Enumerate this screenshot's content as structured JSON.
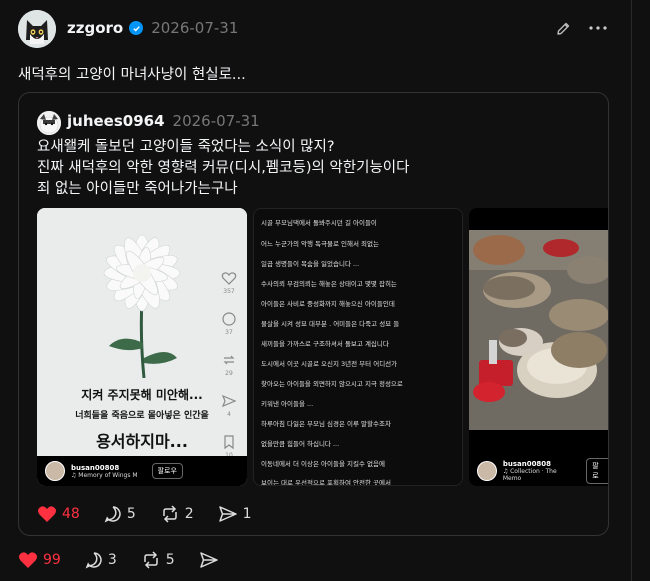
{
  "post": {
    "username": "zzgoro",
    "date": "2026-07-31",
    "text": "새덕후의 고양이 마녀사냥이 현실로...",
    "stats": {
      "likes": "99",
      "comments": "3",
      "reposts": "5"
    }
  },
  "quote": {
    "username": "juhees0964",
    "date": "2026-07-31",
    "lines": [
      "요새왤케 돌보던 고양이들 죽었다는 소식이 많지?",
      "진짜 새덕후의 악한 영향력 커뮤(디시,펨코등)의 악한기능이다",
      "죄 없는 아이들만 죽어나가는구나"
    ],
    "stats": {
      "likes": "48",
      "comments": "5",
      "reposts": "2",
      "shares": "1"
    },
    "media1": {
      "caption1": "지켜 주지못해 미안해...",
      "caption2": "너희들을 죽음으로 몰아넣은 인간을",
      "caption3": "용서하지마...",
      "counts": [
        "357",
        "37",
        "29",
        "4",
        "10"
      ],
      "username": "busan00808",
      "music": "♫ Memory of Wings   M",
      "follow": "팔로우"
    },
    "media2": {
      "lines": [
        "시골 부모님댁에서 돌봐주시던 길 아이들이",
        "어느 누군가의 악행 독극물로 인해서 죄없는",
        "일곱 생명들이 목숨을 잃었습니다 ...",
        "수사의뢰 부검의뢰는 해놓은 상태이고 몇몇 잡히는",
        "아이들은 사비로 중성화까지 해놓으신 아이들인데",
        "물살을 시켜 성묘 대부분 . 어미들은 다죽고 성묘 들",
        "새끼들을 가까스로 구조하셔서 돌보고 계십니다",
        "도시에서 이곳 시골로 오신지 3년전 부터 어디선가",
        "찾아오는 아이들을 외면하지 않으시고 지극 정성으로",
        "키워낸 아이들을 ...",
        "하루아침 다잃은 부모님 심경은 이루 말할수조차",
        "없을만큼 힘들어 하십니다 ...",
        "이동네에서 더 이상은 아이들을 지킬수 없음에",
        "보이는 대로 우선적으로 포획하여 안전한 곳에서"
      ]
    },
    "media3": {
      "username": "busan00808",
      "music": "♫ Collection · The Memo",
      "follow": "팔로"
    }
  }
}
